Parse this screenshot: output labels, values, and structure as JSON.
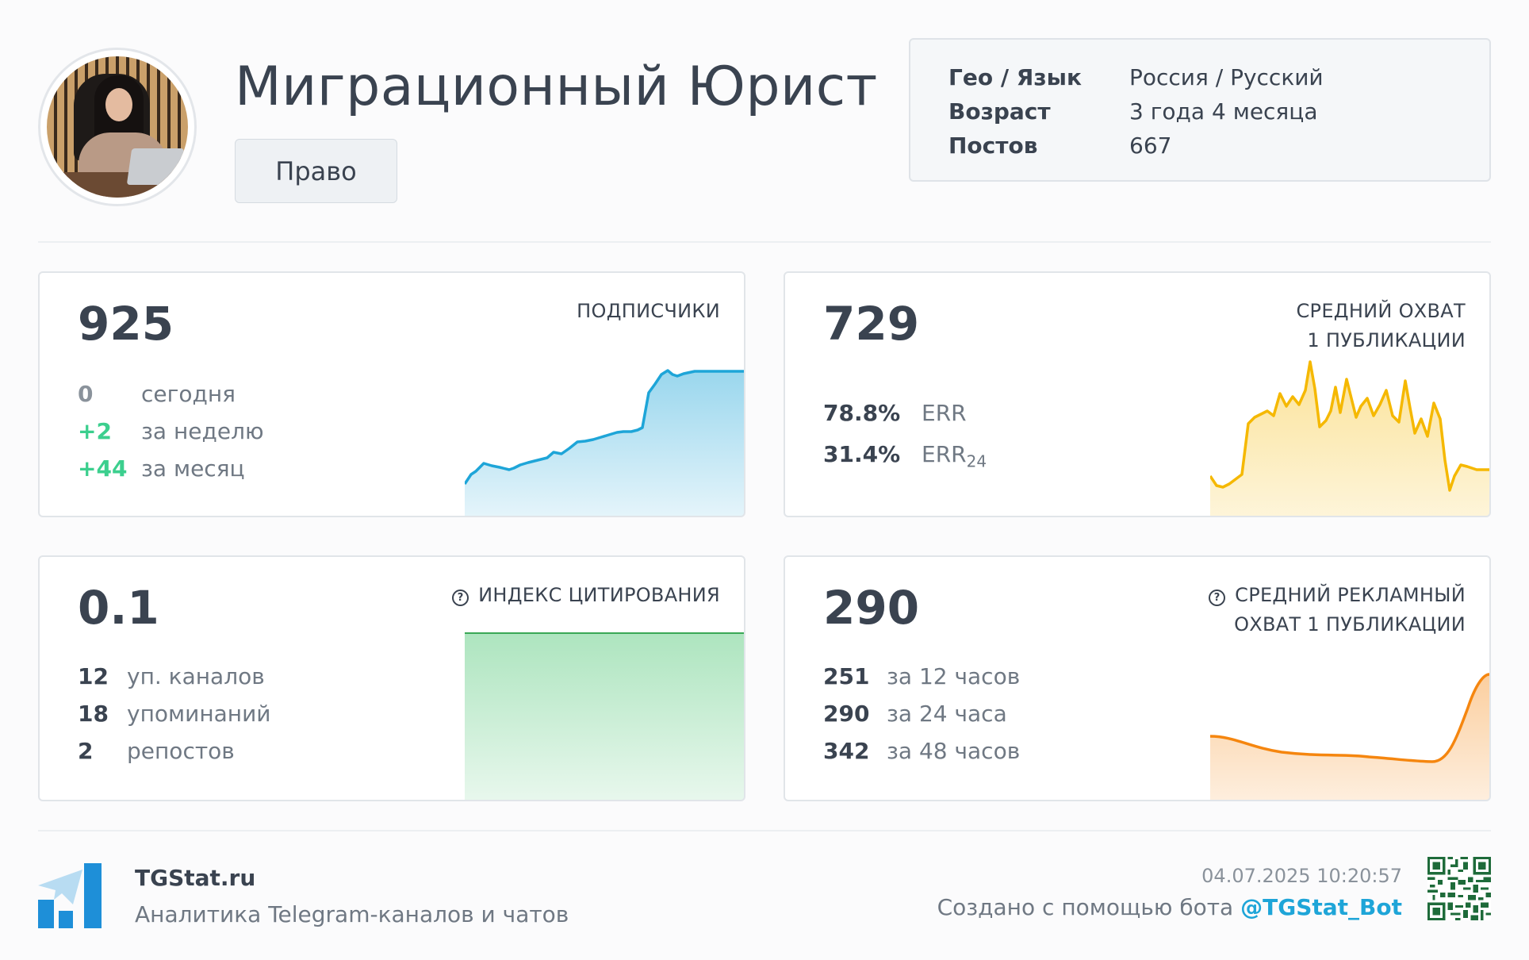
{
  "header": {
    "title": "Миграционный Юрист",
    "category": "Право",
    "info": [
      {
        "key": "Гео / Язык",
        "value": "Россия / Русский"
      },
      {
        "key": "Возраст",
        "value": "3 года 4 месяца"
      },
      {
        "key": "Постов",
        "value": "667"
      }
    ]
  },
  "subscribers": {
    "value": "925",
    "label": "ПОДПИСЧИКИ",
    "today_num": "0",
    "today_txt": "сегодня",
    "week_num": "+2",
    "week_txt": "за неделю",
    "month_num": "+44",
    "month_txt": "за месяц",
    "color": "#1ea5d8"
  },
  "reach": {
    "value": "729",
    "label_line1": "СРЕДНИЙ ОХВАТ",
    "label_line2": "1 ПУБЛИКАЦИИ",
    "err_num": "78.8%",
    "err_txt": "ERR",
    "err24_num": "31.4%",
    "err24_txt": "ERR",
    "err24_sub": "24",
    "color": "#f5b800"
  },
  "citation": {
    "value": "0.1",
    "label": "ИНДЕКС ЦИТИРОВАНИЯ",
    "channels_num": "12",
    "channels_txt": "уп. каналов",
    "mentions_num": "18",
    "mentions_txt": "упоминаний",
    "reposts_num": "2",
    "reposts_txt": "репостов",
    "color": "#3aa856"
  },
  "ad_reach": {
    "value": "290",
    "label_line1": "СРЕДНИЙ РЕКЛАМНЫЙ",
    "label_line2": "ОХВАТ 1 ПУБЛИКАЦИИ",
    "h12_num": "251",
    "h12_txt": "за 12 часов",
    "h24_num": "290",
    "h24_txt": "за 24 часа",
    "h48_num": "342",
    "h48_txt": "за 48 часов",
    "color": "#f5860f"
  },
  "footer": {
    "brand": "TGStat.ru",
    "tagline": "Аналитика Telegram-каналов и чатов",
    "timestamp": "04.07.2025 10:20:57",
    "made_with": "Создано с помощью бота",
    "bot": "@TGStat_Bot"
  },
  "colors": {
    "positive": "#3ccf8e",
    "muted": "#8a929b",
    "text": "#3a4350"
  },
  "icons": [
    "help-circle-icon",
    "tgstat-logo-icon",
    "qr-code-icon"
  ]
}
